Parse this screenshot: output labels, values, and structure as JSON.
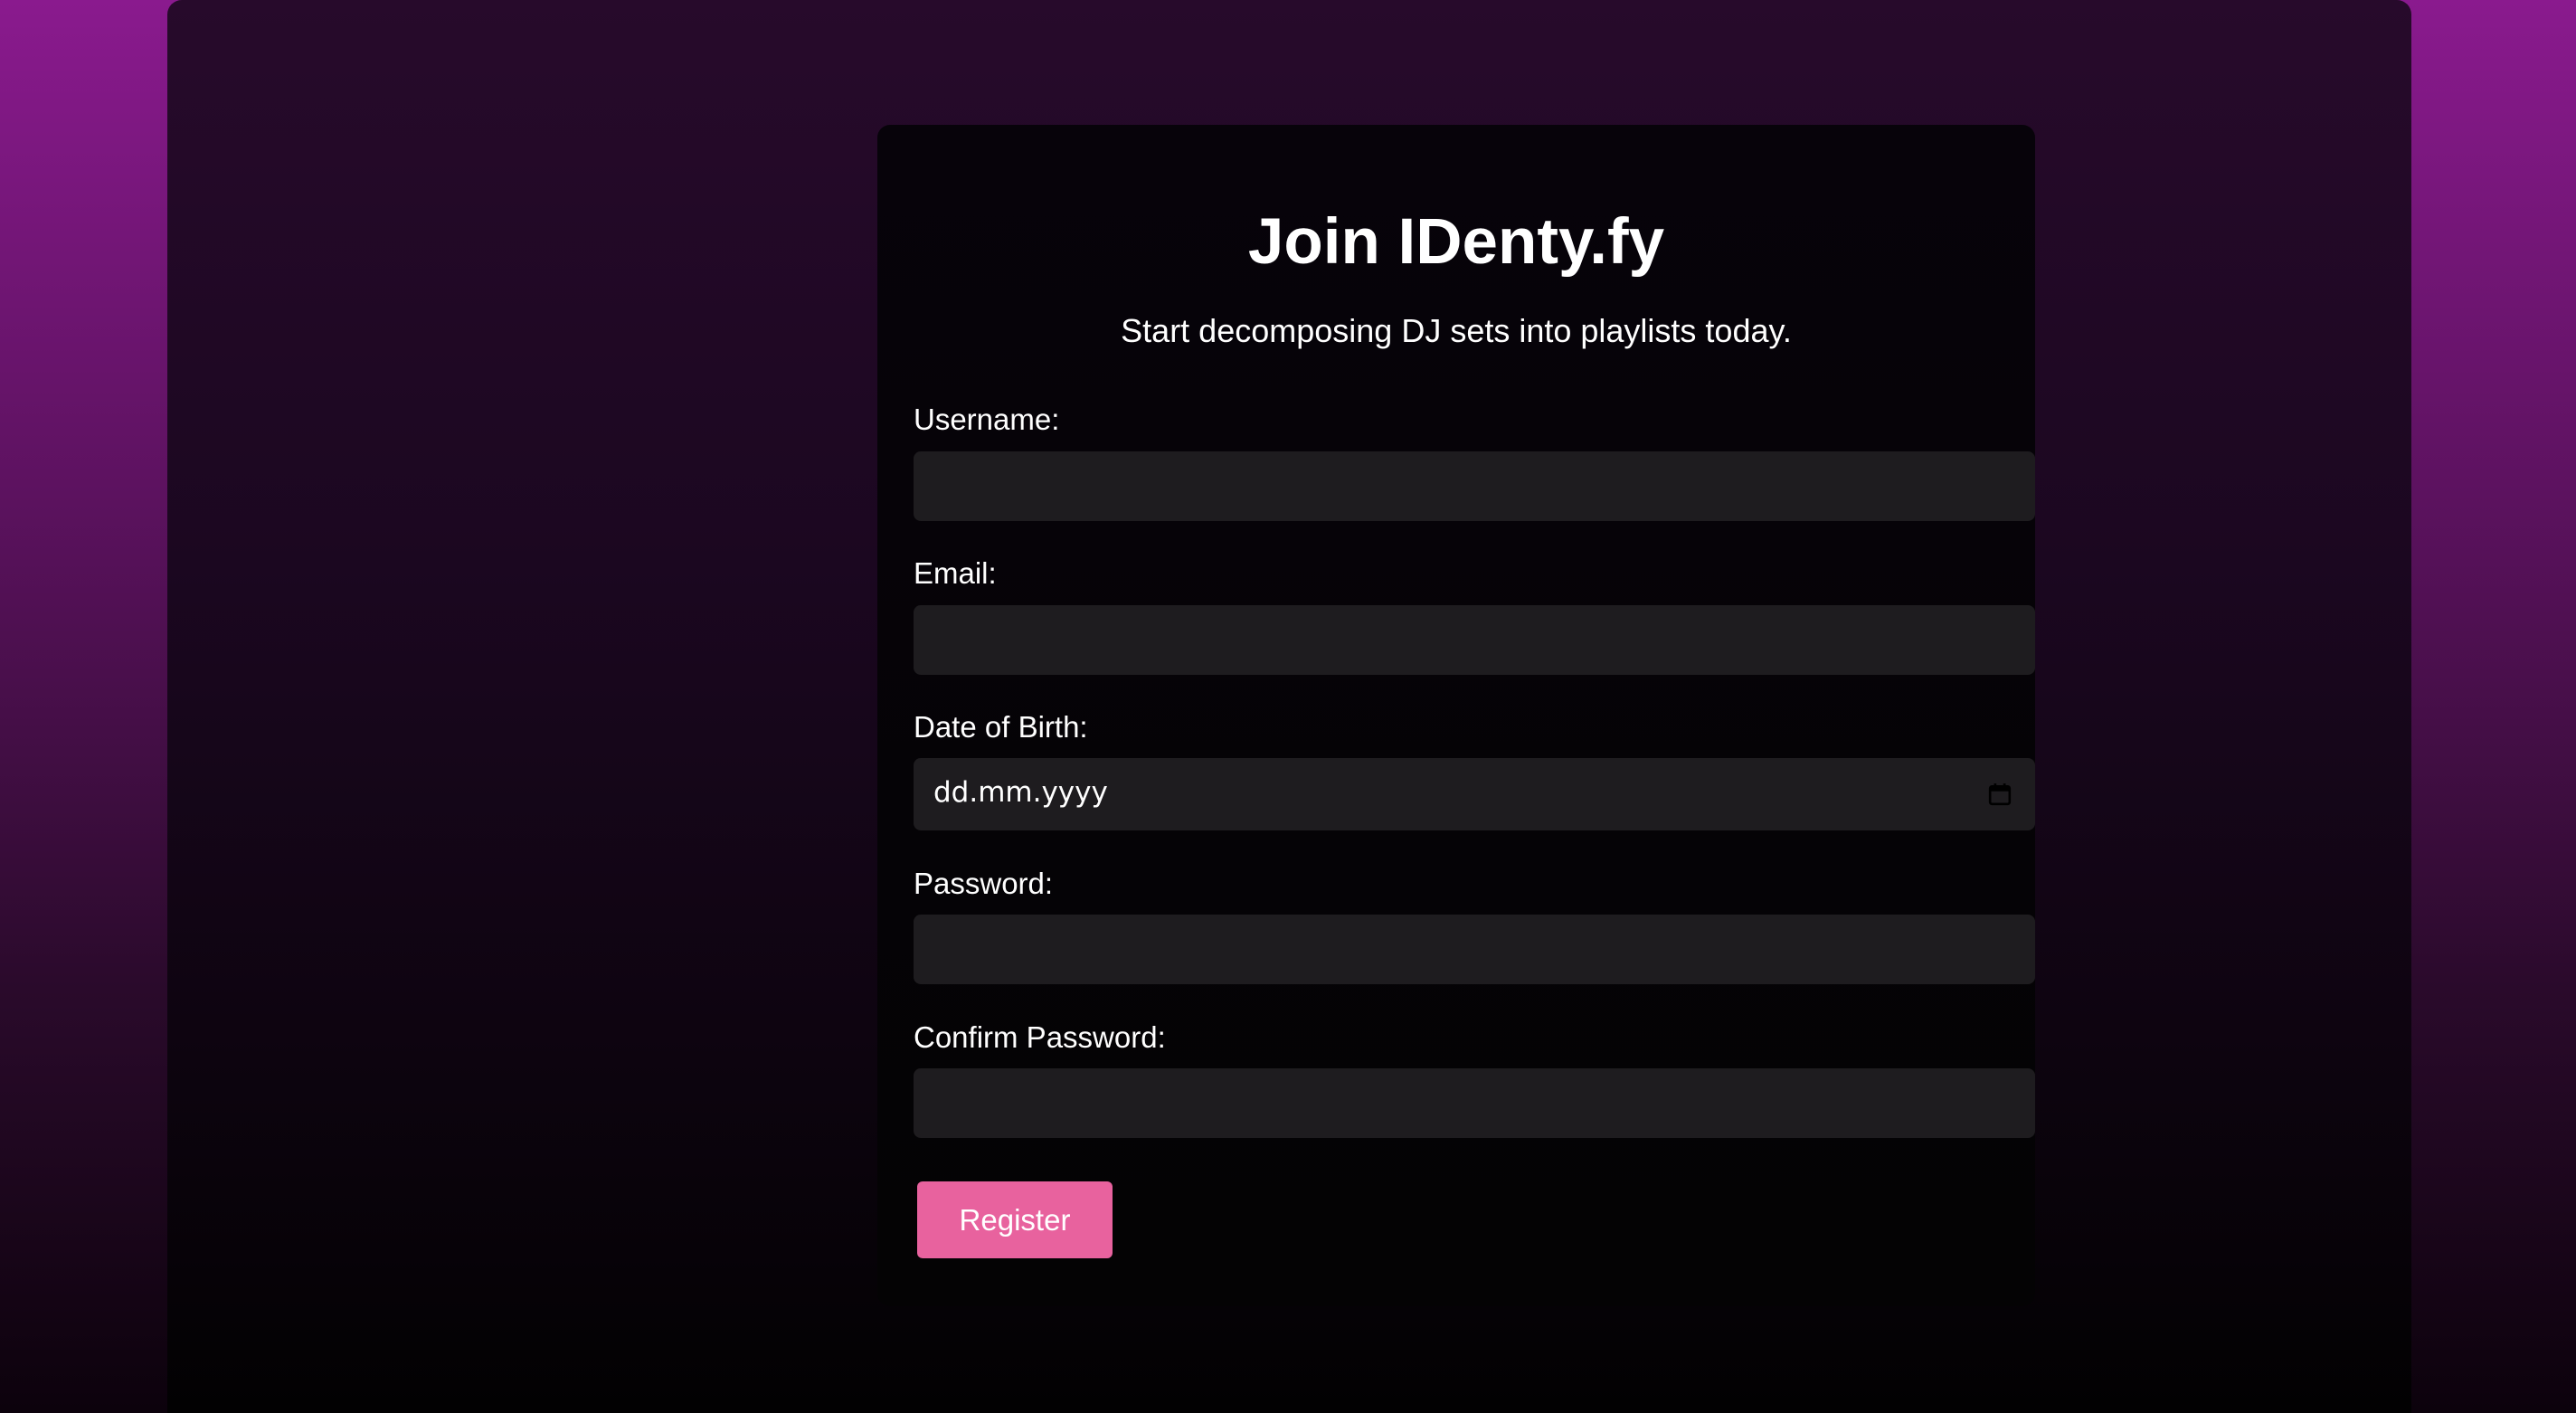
{
  "page": {
    "title": "Join IDenty.fy",
    "subtitle": "Start decomposing DJ sets into playlists today."
  },
  "form": {
    "username": {
      "label": "Username:",
      "value": ""
    },
    "email": {
      "label": "Email:",
      "value": ""
    },
    "dob": {
      "label": "Date of Birth:",
      "placeholder": "dd.mm.yyyy"
    },
    "password": {
      "label": "Password:",
      "value": ""
    },
    "confirm_password": {
      "label": "Confirm Password:",
      "value": ""
    },
    "submit_label": "Register"
  },
  "colors": {
    "accent": "#e8629e",
    "input_bg": "#1e1c1f",
    "card_bg": "#050306",
    "outer_bg_top": "#8a1a8e"
  },
  "icons": {
    "date_picker": "calendar-icon"
  }
}
